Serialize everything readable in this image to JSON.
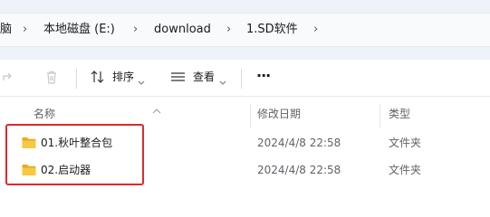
{
  "breadcrumb": {
    "items": [
      "脑",
      "本地磁盘 (E:)",
      "download",
      "1.SD软件"
    ]
  },
  "toolbar": {
    "sort_label": "排序",
    "view_label": "查看",
    "more_label": "···"
  },
  "columns": {
    "name": "名称",
    "date": "修改日期",
    "type": "类型"
  },
  "files": [
    {
      "name": "01.秋叶整合包",
      "date": "2024/4/8 22:58",
      "type": "文件夹"
    },
    {
      "name": "02.启动器",
      "date": "2024/4/8 22:58",
      "type": "文件夹"
    }
  ],
  "colors": {
    "highlight_border": "#e0282a",
    "folder_yellow": "#f4c542"
  }
}
